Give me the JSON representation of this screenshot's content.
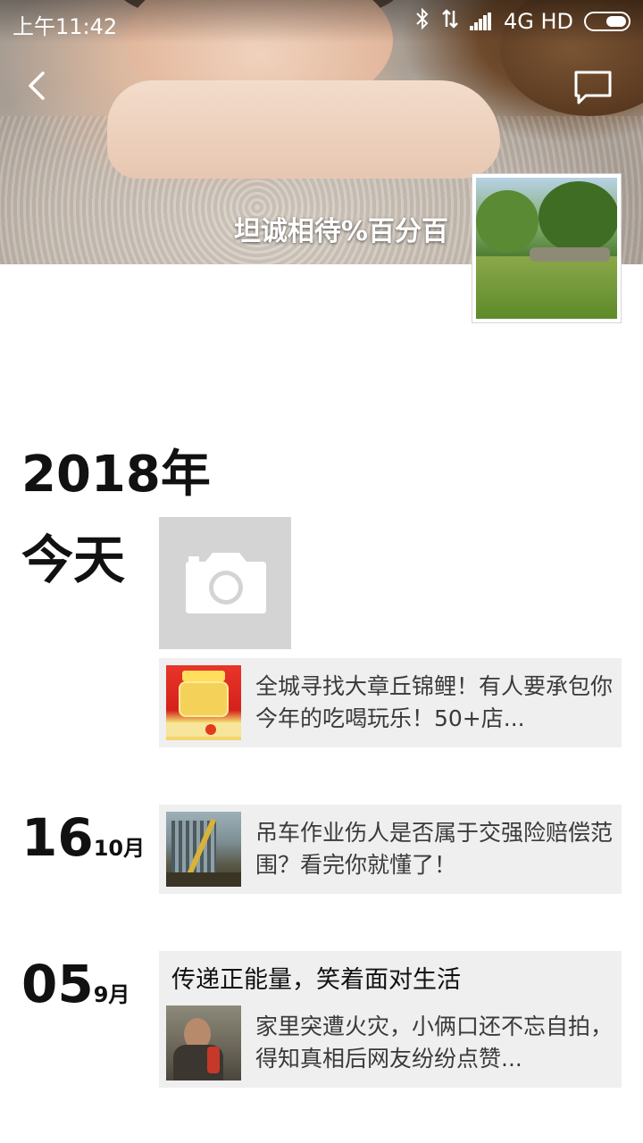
{
  "status_bar": {
    "time": "上午11:42",
    "network": "4G HD",
    "icons": [
      "bluetooth-icon",
      "data-activity-icon",
      "signal-icon",
      "battery-icon"
    ]
  },
  "header": {
    "back_icon": "chevron-left-icon",
    "message_icon": "comment-icon",
    "nickname": "坦诚相待%百分百"
  },
  "timeline": {
    "year": "2018年",
    "today_label": "今天",
    "camera_icon": "camera-icon",
    "entries": [
      {
        "day": "",
        "month": "",
        "caption": "",
        "text": "全城寻找大章丘锦鲤！有人要承包你今年的吃喝玩乐！50+店..."
      },
      {
        "day": "16",
        "month": "10月",
        "caption": "",
        "text": "吊车作业伤人是否属于交强险赔偿范围？看完你就懂了！"
      },
      {
        "day": "05",
        "month": "9月",
        "caption": "传递正能量，笑着面对生活",
        "text": "家里突遭火灾，小俩口还不忘自拍，得知真相后网友纷纷点赞..."
      }
    ]
  },
  "colors": {
    "card_bg": "#efefef",
    "camera_tile_bg": "#d4d4d4",
    "text_dark": "#111111",
    "text_card": "#3a3a3a"
  }
}
